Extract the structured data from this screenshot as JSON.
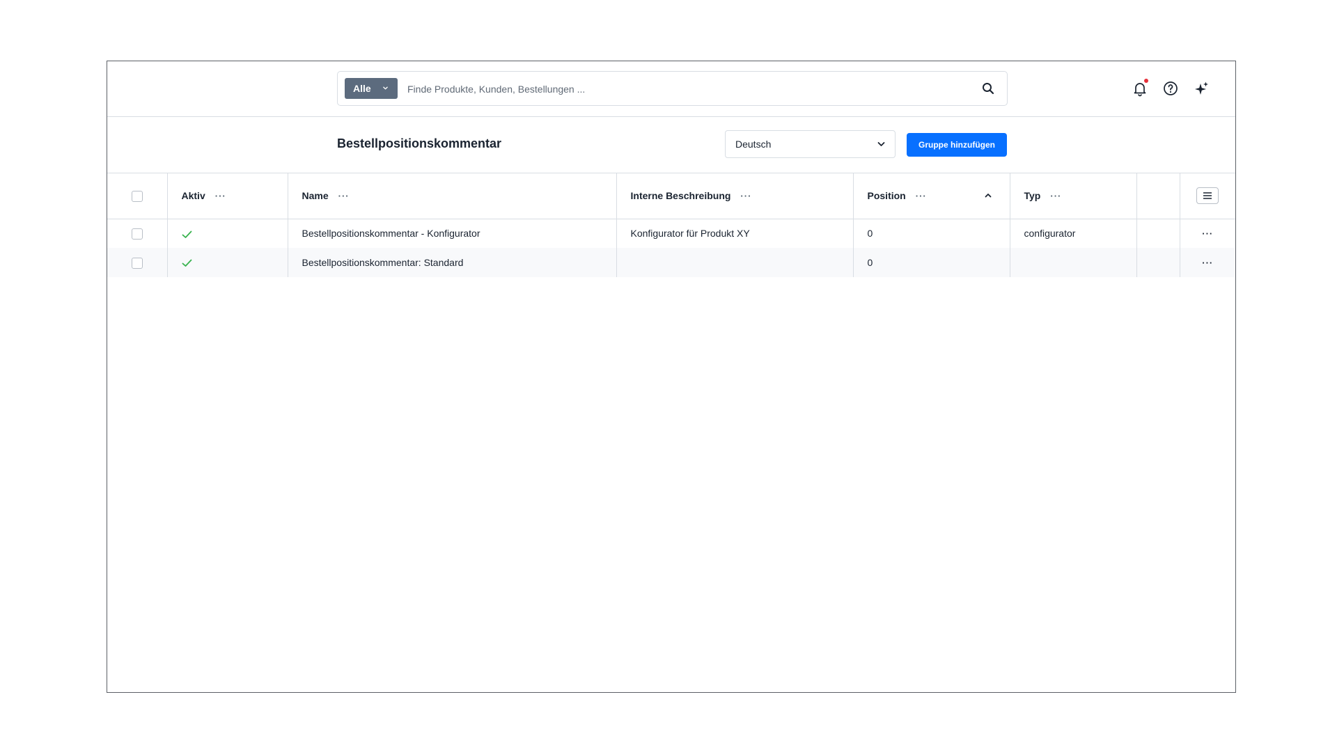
{
  "search": {
    "type_label": "Alle",
    "placeholder": "Finde Produkte, Kunden, Bestellungen ..."
  },
  "header": {
    "title": "Bestellpositionskommentar",
    "language": "Deutsch",
    "add_button": "Gruppe hinzufügen"
  },
  "table": {
    "columns": {
      "active": "Aktiv",
      "name": "Name",
      "description": "Interne Beschreibung",
      "position": "Position",
      "type": "Typ"
    },
    "column_menu_glyph": "···",
    "row_menu_glyph": "···",
    "rows": [
      {
        "active": true,
        "name": "Bestellpositionskommentar - Konfigurator",
        "description": "Konfigurator für Produkt XY",
        "position": "0",
        "type": "configurator"
      },
      {
        "active": true,
        "name": "Bestellpositionskommentar: Standard",
        "description": "",
        "position": "0",
        "type": ""
      }
    ]
  },
  "colors": {
    "primary": "#0870ff",
    "search_type_bg": "#5c6b7e",
    "notification_dot": "#e5303a",
    "active_check": "#37b24d"
  },
  "icons": [
    "chevron-down-icon",
    "search-icon",
    "bell-icon",
    "help-icon",
    "sparkle-icon",
    "check-icon",
    "sort-asc-icon",
    "list-menu-icon"
  ]
}
